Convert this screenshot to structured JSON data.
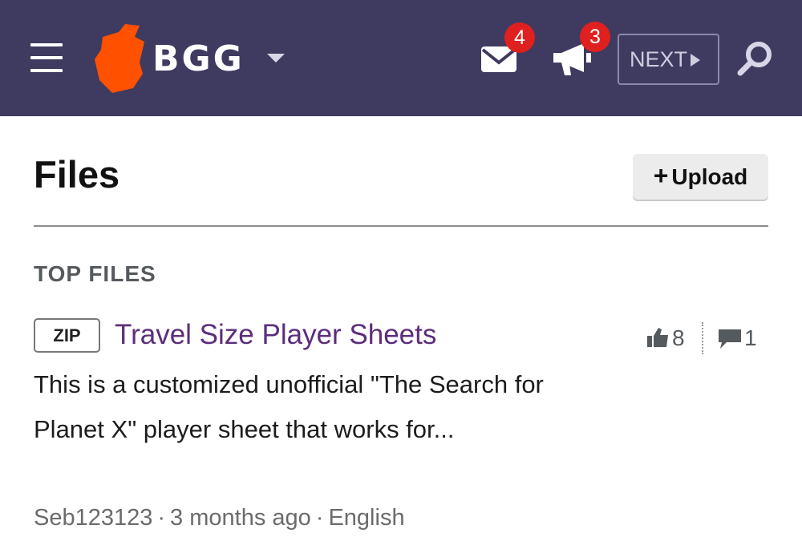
{
  "header": {
    "logo_text": "BGG",
    "mail_badge": "4",
    "notifications_badge": "3",
    "next_label": "NEXT",
    "colors": {
      "bar": "#3f3a60",
      "logo_orange": "#ff5100",
      "badge_red": "#e0201f"
    },
    "icons": [
      "hamburger-menu-icon",
      "bgg-logo-icon",
      "chevron-down-icon",
      "envelope-icon",
      "megaphone-icon",
      "play-triangle-icon",
      "search-icon"
    ]
  },
  "page": {
    "title": "Files",
    "upload_label": "Upload",
    "section_heading": "TOP FILES"
  },
  "files": [
    {
      "type": "ZIP",
      "title": "Travel Size Player Sheets",
      "description": "This is a customized unofficial \"The Search for Planet X\" player sheet that works for...",
      "author": "Seb123123",
      "age": "3 months ago",
      "language": "English",
      "thumbs": "8",
      "comments": "1",
      "colors": {
        "title": "#5d2d7d"
      },
      "icons": [
        "thumbs-up-icon",
        "comment-icon"
      ]
    }
  ]
}
